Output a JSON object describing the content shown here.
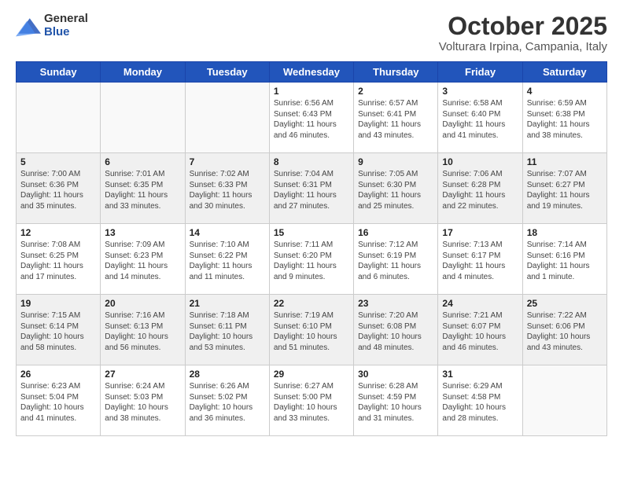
{
  "logo": {
    "general": "General",
    "blue": "Blue"
  },
  "header": {
    "title": "October 2025",
    "subtitle": "Volturara Irpina, Campania, Italy"
  },
  "weekdays": [
    "Sunday",
    "Monday",
    "Tuesday",
    "Wednesday",
    "Thursday",
    "Friday",
    "Saturday"
  ],
  "weeks": [
    [
      {
        "day": "",
        "text": "",
        "empty": true
      },
      {
        "day": "",
        "text": "",
        "empty": true
      },
      {
        "day": "",
        "text": "",
        "empty": true
      },
      {
        "day": "1",
        "text": "Sunrise: 6:56 AM\nSunset: 6:43 PM\nDaylight: 11 hours\nand 46 minutes.",
        "empty": false
      },
      {
        "day": "2",
        "text": "Sunrise: 6:57 AM\nSunset: 6:41 PM\nDaylight: 11 hours\nand 43 minutes.",
        "empty": false
      },
      {
        "day": "3",
        "text": "Sunrise: 6:58 AM\nSunset: 6:40 PM\nDaylight: 11 hours\nand 41 minutes.",
        "empty": false
      },
      {
        "day": "4",
        "text": "Sunrise: 6:59 AM\nSunset: 6:38 PM\nDaylight: 11 hours\nand 38 minutes.",
        "empty": false
      }
    ],
    [
      {
        "day": "5",
        "text": "Sunrise: 7:00 AM\nSunset: 6:36 PM\nDaylight: 11 hours\nand 35 minutes.",
        "empty": false
      },
      {
        "day": "6",
        "text": "Sunrise: 7:01 AM\nSunset: 6:35 PM\nDaylight: 11 hours\nand 33 minutes.",
        "empty": false
      },
      {
        "day": "7",
        "text": "Sunrise: 7:02 AM\nSunset: 6:33 PM\nDaylight: 11 hours\nand 30 minutes.",
        "empty": false
      },
      {
        "day": "8",
        "text": "Sunrise: 7:04 AM\nSunset: 6:31 PM\nDaylight: 11 hours\nand 27 minutes.",
        "empty": false
      },
      {
        "day": "9",
        "text": "Sunrise: 7:05 AM\nSunset: 6:30 PM\nDaylight: 11 hours\nand 25 minutes.",
        "empty": false
      },
      {
        "day": "10",
        "text": "Sunrise: 7:06 AM\nSunset: 6:28 PM\nDaylight: 11 hours\nand 22 minutes.",
        "empty": false
      },
      {
        "day": "11",
        "text": "Sunrise: 7:07 AM\nSunset: 6:27 PM\nDaylight: 11 hours\nand 19 minutes.",
        "empty": false
      }
    ],
    [
      {
        "day": "12",
        "text": "Sunrise: 7:08 AM\nSunset: 6:25 PM\nDaylight: 11 hours\nand 17 minutes.",
        "empty": false
      },
      {
        "day": "13",
        "text": "Sunrise: 7:09 AM\nSunset: 6:23 PM\nDaylight: 11 hours\nand 14 minutes.",
        "empty": false
      },
      {
        "day": "14",
        "text": "Sunrise: 7:10 AM\nSunset: 6:22 PM\nDaylight: 11 hours\nand 11 minutes.",
        "empty": false
      },
      {
        "day": "15",
        "text": "Sunrise: 7:11 AM\nSunset: 6:20 PM\nDaylight: 11 hours\nand 9 minutes.",
        "empty": false
      },
      {
        "day": "16",
        "text": "Sunrise: 7:12 AM\nSunset: 6:19 PM\nDaylight: 11 hours\nand 6 minutes.",
        "empty": false
      },
      {
        "day": "17",
        "text": "Sunrise: 7:13 AM\nSunset: 6:17 PM\nDaylight: 11 hours\nand 4 minutes.",
        "empty": false
      },
      {
        "day": "18",
        "text": "Sunrise: 7:14 AM\nSunset: 6:16 PM\nDaylight: 11 hours\nand 1 minute.",
        "empty": false
      }
    ],
    [
      {
        "day": "19",
        "text": "Sunrise: 7:15 AM\nSunset: 6:14 PM\nDaylight: 10 hours\nand 58 minutes.",
        "empty": false
      },
      {
        "day": "20",
        "text": "Sunrise: 7:16 AM\nSunset: 6:13 PM\nDaylight: 10 hours\nand 56 minutes.",
        "empty": false
      },
      {
        "day": "21",
        "text": "Sunrise: 7:18 AM\nSunset: 6:11 PM\nDaylight: 10 hours\nand 53 minutes.",
        "empty": false
      },
      {
        "day": "22",
        "text": "Sunrise: 7:19 AM\nSunset: 6:10 PM\nDaylight: 10 hours\nand 51 minutes.",
        "empty": false
      },
      {
        "day": "23",
        "text": "Sunrise: 7:20 AM\nSunset: 6:08 PM\nDaylight: 10 hours\nand 48 minutes.",
        "empty": false
      },
      {
        "day": "24",
        "text": "Sunrise: 7:21 AM\nSunset: 6:07 PM\nDaylight: 10 hours\nand 46 minutes.",
        "empty": false
      },
      {
        "day": "25",
        "text": "Sunrise: 7:22 AM\nSunset: 6:06 PM\nDaylight: 10 hours\nand 43 minutes.",
        "empty": false
      }
    ],
    [
      {
        "day": "26",
        "text": "Sunrise: 6:23 AM\nSunset: 5:04 PM\nDaylight: 10 hours\nand 41 minutes.",
        "empty": false
      },
      {
        "day": "27",
        "text": "Sunrise: 6:24 AM\nSunset: 5:03 PM\nDaylight: 10 hours\nand 38 minutes.",
        "empty": false
      },
      {
        "day": "28",
        "text": "Sunrise: 6:26 AM\nSunset: 5:02 PM\nDaylight: 10 hours\nand 36 minutes.",
        "empty": false
      },
      {
        "day": "29",
        "text": "Sunrise: 6:27 AM\nSunset: 5:00 PM\nDaylight: 10 hours\nand 33 minutes.",
        "empty": false
      },
      {
        "day": "30",
        "text": "Sunrise: 6:28 AM\nSunset: 4:59 PM\nDaylight: 10 hours\nand 31 minutes.",
        "empty": false
      },
      {
        "day": "31",
        "text": "Sunrise: 6:29 AM\nSunset: 4:58 PM\nDaylight: 10 hours\nand 28 minutes.",
        "empty": false
      },
      {
        "day": "",
        "text": "",
        "empty": true
      }
    ]
  ]
}
